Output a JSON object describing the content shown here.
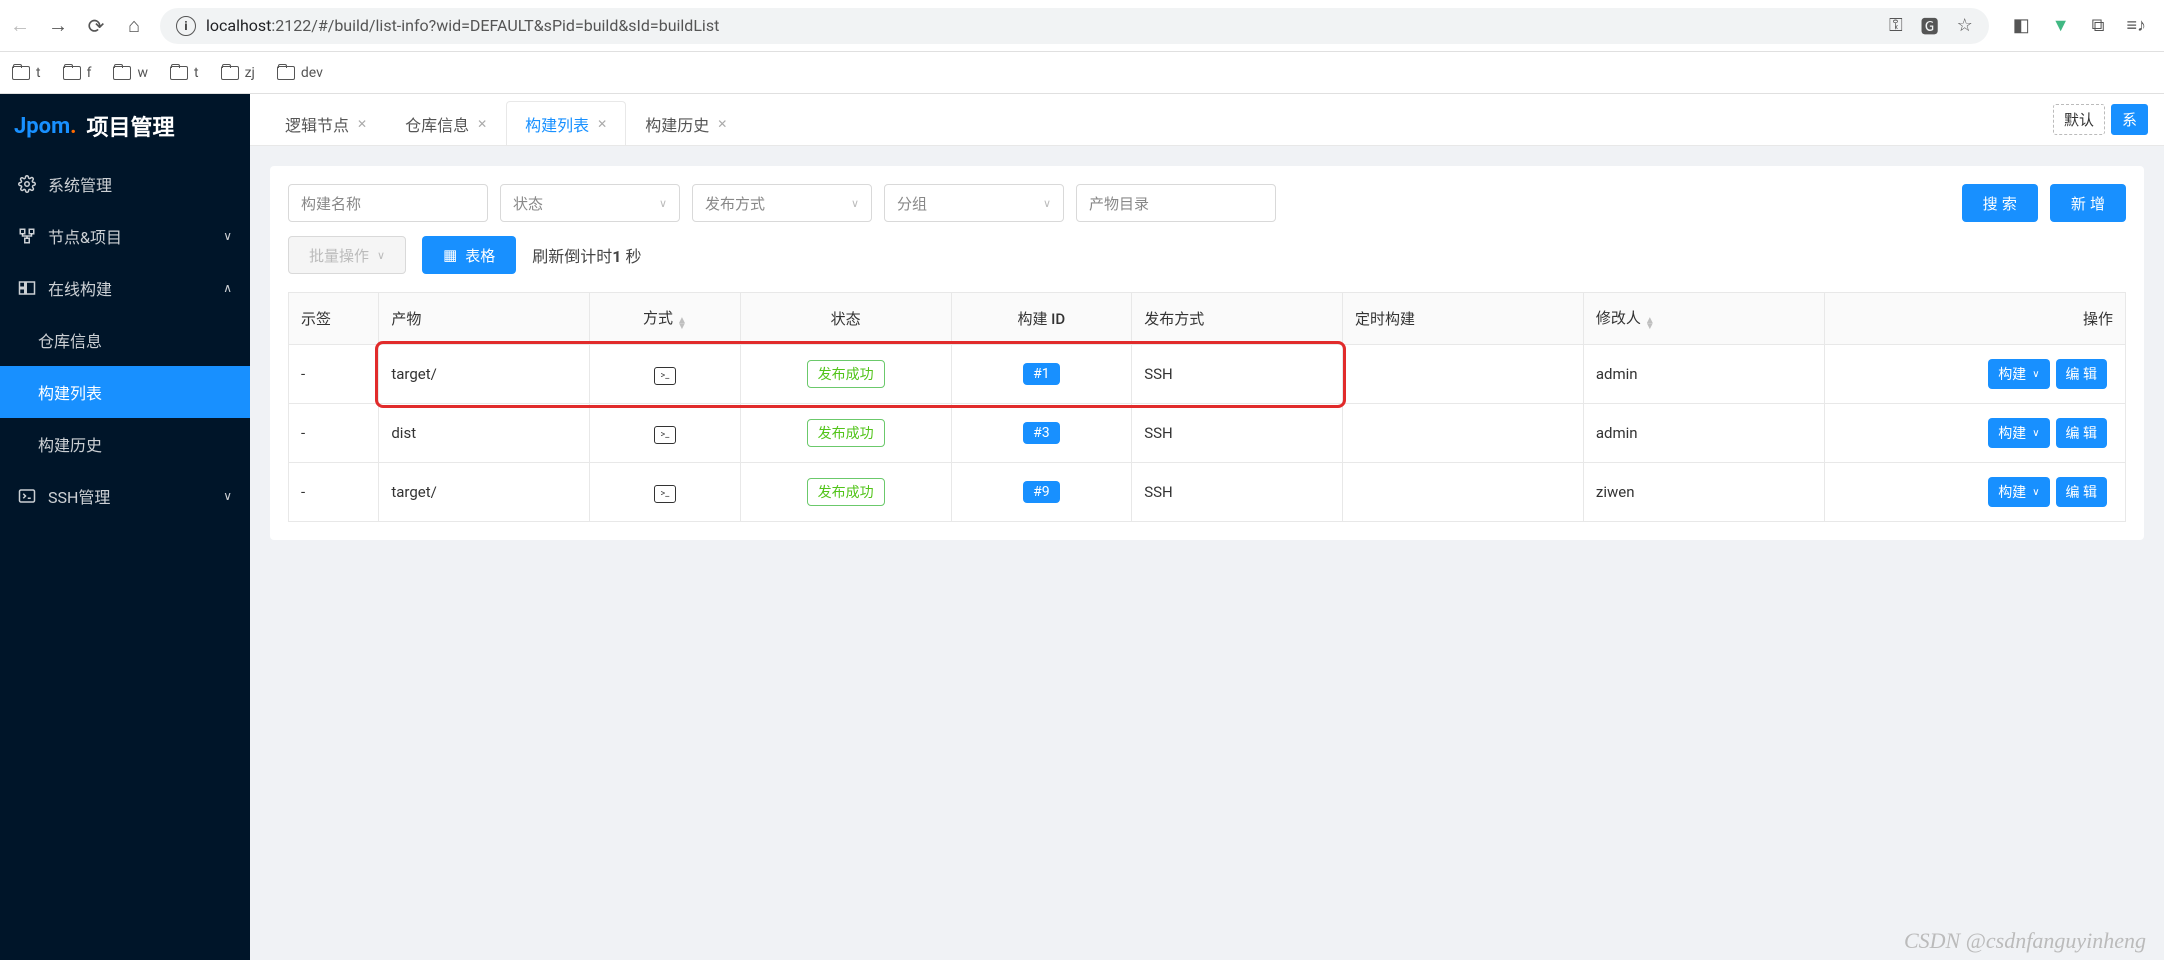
{
  "browser": {
    "url_host": "localhost",
    "url_rest": ":2122/#/build/list-info?wid=DEFAULT&sPid=build&sId=buildList"
  },
  "bookmarks": [
    {
      "label": "t"
    },
    {
      "label": "f"
    },
    {
      "label": "w"
    },
    {
      "label": "t"
    },
    {
      "label": "zj"
    },
    {
      "label": "dev"
    }
  ],
  "sidebar": {
    "logo_brand": "Jpom",
    "logo_title": "项目管理",
    "items": [
      {
        "icon": "gear",
        "label": "系统管理",
        "arrow": ""
      },
      {
        "icon": "nodes",
        "label": "节点&项目",
        "arrow": "∨"
      },
      {
        "icon": "build",
        "label": "在线构建",
        "arrow": "∧"
      },
      {
        "icon": "",
        "label": "仓库信息",
        "sub": true
      },
      {
        "icon": "",
        "label": "构建列表",
        "sub": true,
        "selected": true
      },
      {
        "icon": "",
        "label": "构建历史",
        "sub": true
      },
      {
        "icon": "terminal",
        "label": "SSH管理",
        "arrow": "∨"
      }
    ]
  },
  "tabs": {
    "items": [
      {
        "label": "逻辑节点",
        "active": false
      },
      {
        "label": "仓库信息",
        "active": false
      },
      {
        "label": "构建列表",
        "active": true
      },
      {
        "label": "构建历史",
        "active": false
      }
    ],
    "workspace_default": "默认",
    "workspace_more": "系"
  },
  "filters": {
    "name_placeholder": "构建名称",
    "status_placeholder": "状态",
    "release_placeholder": "发布方式",
    "group_placeholder": "分组",
    "output_placeholder": "产物目录",
    "search_label": "搜 索",
    "add_label": "新 增",
    "batch_label": "批量操作",
    "table_label": "表格",
    "countdown_prefix": "刷新倒计时",
    "countdown_value": "1",
    "countdown_suffix": " 秒"
  },
  "table": {
    "headers": {
      "tag": "示签",
      "product": "产物",
      "method": "方式",
      "status": "状态",
      "build_id": "构建 ID",
      "release": "发布方式",
      "cron": "定时构建",
      "modifier": "修改人",
      "ops": "操作"
    },
    "rows": [
      {
        "tag": "-",
        "product": "target/",
        "method": "terminal",
        "status": "发布成功",
        "build_id": "#1",
        "release": "SSH",
        "cron": "",
        "modifier": "admin",
        "highlight": true
      },
      {
        "tag": "-",
        "product": "dist",
        "method": "terminal",
        "status": "发布成功",
        "build_id": "#3",
        "release": "SSH",
        "cron": "",
        "modifier": "admin"
      },
      {
        "tag": "-",
        "product": "target/",
        "method": "terminal",
        "status": "发布成功",
        "build_id": "#9",
        "release": "SSH",
        "cron": "",
        "modifier": "ziwen"
      }
    ],
    "op_build": "构建",
    "op_edit": "编 辑"
  },
  "watermark": "CSDN @csdnfanguyinheng"
}
